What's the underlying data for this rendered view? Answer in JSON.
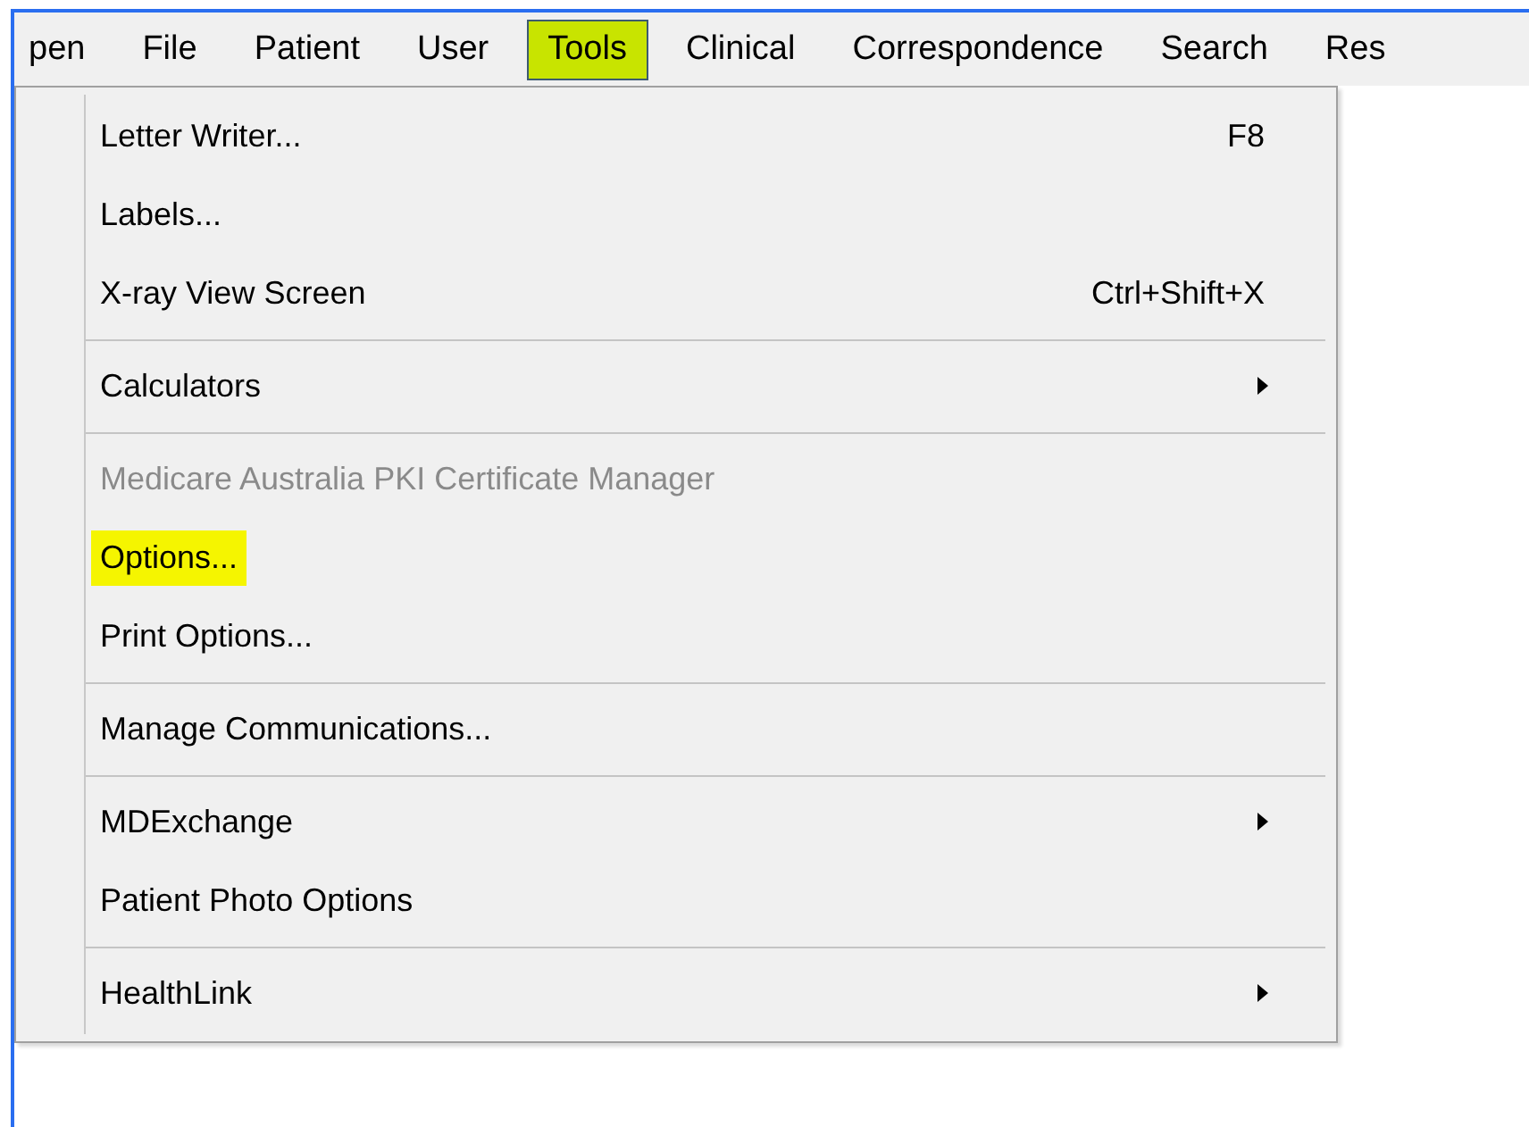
{
  "menu_bar": [
    {
      "label": "pen",
      "selected": false
    },
    {
      "label": "File",
      "selected": false
    },
    {
      "label": "Patient",
      "selected": false
    },
    {
      "label": "User",
      "selected": false
    },
    {
      "label": "Tools",
      "selected": true
    },
    {
      "label": "Clinical",
      "selected": false
    },
    {
      "label": "Correspondence",
      "selected": false
    },
    {
      "label": "Search",
      "selected": false
    },
    {
      "label": "Res",
      "selected": false
    }
  ],
  "tools_menu": [
    {
      "kind": "item",
      "label": "Letter Writer...",
      "shortcut": "F8",
      "submenu": false,
      "disabled": false,
      "highlighted": false
    },
    {
      "kind": "item",
      "label": "Labels...",
      "submenu": false,
      "disabled": false,
      "highlighted": false
    },
    {
      "kind": "item",
      "label": "X-ray View Screen",
      "shortcut": "Ctrl+Shift+X",
      "submenu": false,
      "disabled": false,
      "highlighted": false
    },
    {
      "kind": "separator"
    },
    {
      "kind": "item",
      "label": "Calculators",
      "submenu": true,
      "disabled": false,
      "highlighted": false
    },
    {
      "kind": "separator"
    },
    {
      "kind": "item",
      "label": "Medicare Australia PKI Certificate Manager",
      "submenu": false,
      "disabled": true,
      "highlighted": false
    },
    {
      "kind": "item",
      "label": "Options...",
      "submenu": false,
      "disabled": false,
      "highlighted": true
    },
    {
      "kind": "item",
      "label": "Print Options...",
      "submenu": false,
      "disabled": false,
      "highlighted": false
    },
    {
      "kind": "separator"
    },
    {
      "kind": "item",
      "label": "Manage Communications...",
      "submenu": false,
      "disabled": false,
      "highlighted": false
    },
    {
      "kind": "separator"
    },
    {
      "kind": "item",
      "label": "MDExchange",
      "submenu": true,
      "disabled": false,
      "highlighted": false
    },
    {
      "kind": "item",
      "label": "Patient Photo Options",
      "submenu": false,
      "disabled": false,
      "highlighted": false
    },
    {
      "kind": "separator"
    },
    {
      "kind": "item",
      "label": "HealthLink",
      "submenu": true,
      "disabled": false,
      "highlighted": false
    }
  ]
}
